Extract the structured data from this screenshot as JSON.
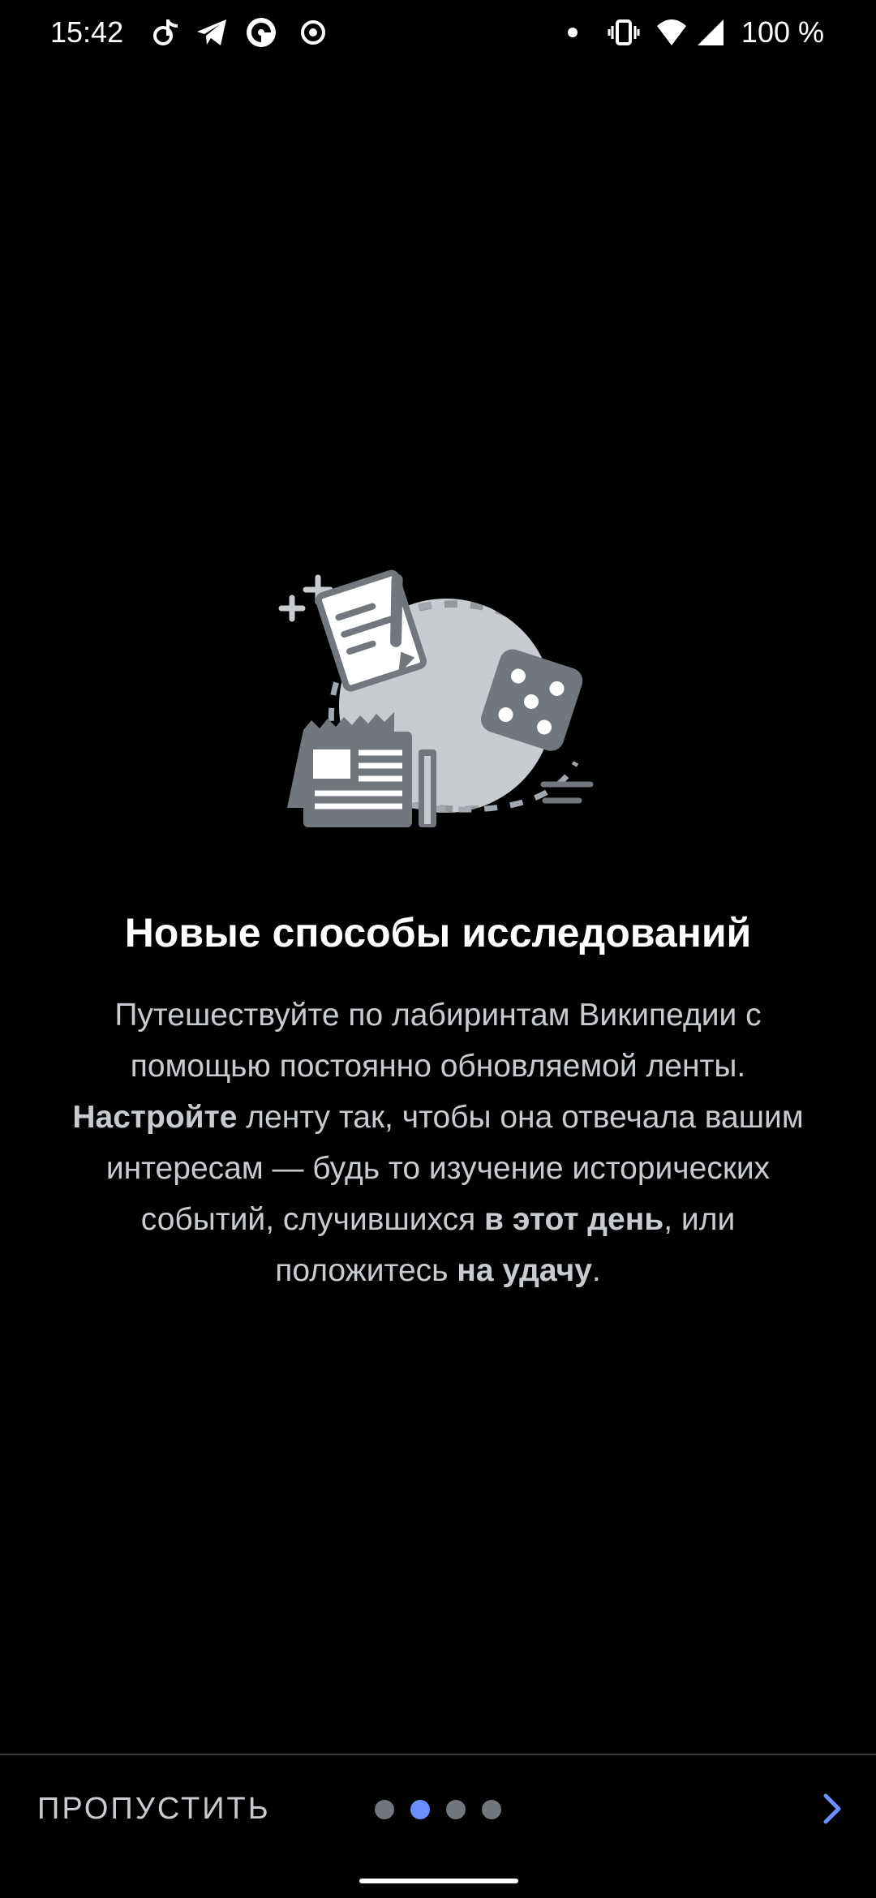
{
  "status_bar": {
    "time": "15:42",
    "battery_text": "100 %",
    "left_icons": [
      "tiktok-icon",
      "telegram-icon",
      "shutter-app-icon",
      "record-icon"
    ],
    "right_icons": [
      "notification-dot-icon",
      "vibrate-icon",
      "wifi-icon",
      "cell-signal-icon"
    ]
  },
  "onboarding": {
    "illustration_icon": "explore-feed-illustration",
    "title": "Новые способы исследований",
    "body": {
      "line1": "Путешествуйте по лабиринтам Википедии с помощью постоянно обновляемой ленты.",
      "bold1": "Настройте",
      "text2": " ленту так, чтобы она отвечала вашим интересам — будь то изучение исторических событий, случившихся ",
      "bold2": "в этот день",
      "text3": ", или положитесь ",
      "bold3": "на удачу",
      "text4": "."
    }
  },
  "bottom_bar": {
    "skip_label": "ПРОПУСТИТЬ",
    "page_count": 4,
    "active_page": 2,
    "next_icon": "chevron-right-icon"
  },
  "colors": {
    "background": "#000000",
    "title": "#ffffff",
    "body_text": "#c8ccd1",
    "accent": "#6b8fff",
    "inactive_dot": "#72777d"
  }
}
